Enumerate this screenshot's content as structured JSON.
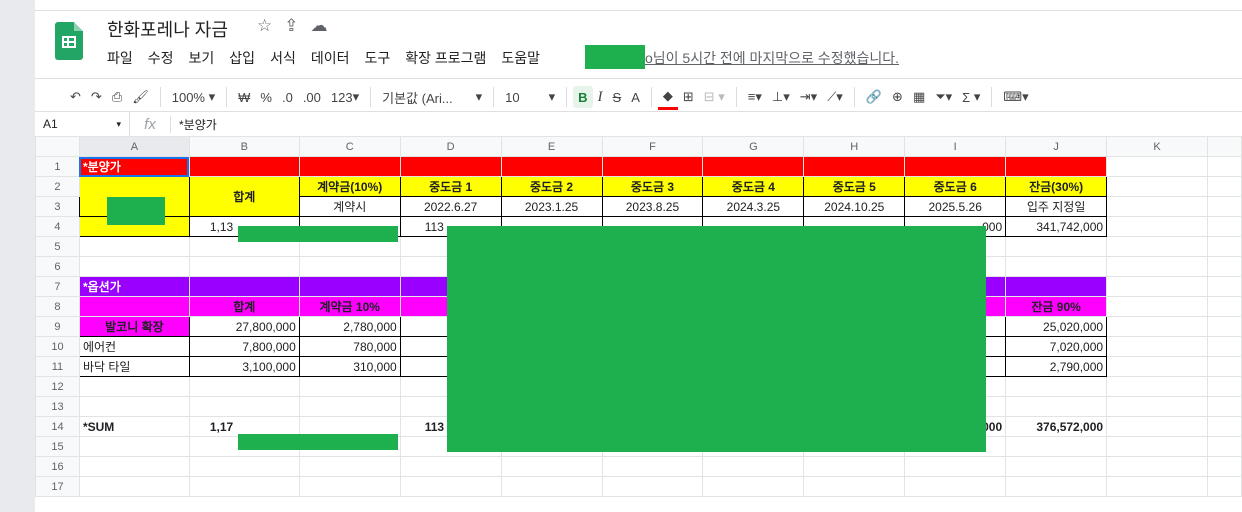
{
  "doc": {
    "title": "한화포레나 자금",
    "edit_msg": "o님이 5시간 전에 마지막으로 수정했습니다."
  },
  "menu": [
    "파일",
    "수정",
    "보기",
    "삽입",
    "서식",
    "데이터",
    "도구",
    "확장 프로그램",
    "도움말"
  ],
  "title_icons": [
    "star-icon",
    "move-to-drive-icon",
    "cloud-status-icon"
  ],
  "toolbar": {
    "zoom": "100%",
    "currency": "₩",
    "percent": "%",
    "dec_decrease": ".0",
    "dec_increase": ".00",
    "format_123": "123",
    "font": "기본값 (Ari...",
    "font_size": "10",
    "bold": "B",
    "italic": "I",
    "strike": "S",
    "text_color": "A",
    "sum": "Σ"
  },
  "formula_bar": {
    "cell_ref": "A1",
    "fx": "fx",
    "value": "*분양가"
  },
  "columns": [
    "A",
    "B",
    "C",
    "D",
    "E",
    "F",
    "G",
    "H",
    "I",
    "J",
    "K"
  ],
  "rows": {
    "r1": {
      "a": "*분양가"
    },
    "r2": {
      "b": "합계",
      "c": "계약금(10%)",
      "d": "중도금 1",
      "e": "중도금 2",
      "f": "중도금 3",
      "g": "중도금 4",
      "h": "중도금 5",
      "i": "중도금 6",
      "j": "잔금(30%)"
    },
    "r3": {
      "c": "계약시",
      "d": "2022.6.27",
      "e": "2023.1.25",
      "f": "2023.8.25",
      "g": "2024.3.25",
      "h": "2024.10.25",
      "i": "2025.5.26",
      "j": "입주 지정일"
    },
    "r4": {
      "b": "1,13",
      "d": "113",
      "i": "000",
      "j": "341,742,000"
    },
    "r7": {
      "a": "*옵션가"
    },
    "r8": {
      "b": "합계",
      "c": "계약금 10%",
      "j": "잔금 90%"
    },
    "r9": {
      "a": "발코니 확장",
      "b": "27,800,000",
      "c": "2,780,000",
      "j": "25,020,000"
    },
    "r10": {
      "a": "에어컨",
      "b": "7,800,000",
      "c": "780,000",
      "j": "7,020,000"
    },
    "r11": {
      "a": "바닥 타일",
      "b": "3,100,000",
      "c": "310,000",
      "j": "2,790,000"
    },
    "r14": {
      "a": "*SUM",
      "b": "1,17",
      "d": "113",
      "i": "000",
      "j": "376,572,000"
    }
  },
  "colors": {
    "red": "#ff0000",
    "yellow": "#ffff00",
    "purple": "#9900ff",
    "magenta": "#ff00ff",
    "redact_green": "#1eb04e",
    "sheets_green": "#23a566"
  }
}
